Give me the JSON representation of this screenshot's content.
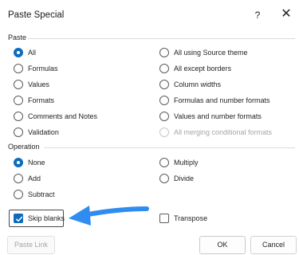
{
  "dialog": {
    "title": "Paste Special",
    "help_label": "?",
    "close_label": "✕"
  },
  "paste": {
    "label": "Paste",
    "selected": "All",
    "options_left": [
      "All",
      "Formulas",
      "Values",
      "Formats",
      "Comments and Notes",
      "Validation"
    ],
    "options_right": [
      "All using Source theme",
      "All except borders",
      "Column widths",
      "Formulas and number formats",
      "Values and number formats",
      "All merging conditional formats"
    ],
    "disabled": [
      "All merging conditional formats"
    ]
  },
  "operation": {
    "label": "Operation",
    "selected": "None",
    "options_left": [
      "None",
      "Add",
      "Subtract"
    ],
    "options_right": [
      "Multiply",
      "Divide"
    ]
  },
  "checks": {
    "skip_blanks": {
      "label": "Skip blanks",
      "checked": true
    },
    "transpose": {
      "label": "Transpose",
      "checked": false
    }
  },
  "buttons": {
    "paste_link": "Paste Link",
    "ok": "OK",
    "cancel": "Cancel"
  },
  "colors": {
    "accent": "#0f6cbd",
    "arrow": "#2f8cf0"
  },
  "icons": {
    "arrow": "pointing-arrow-icon",
    "checkmark": "checkmark-icon"
  }
}
